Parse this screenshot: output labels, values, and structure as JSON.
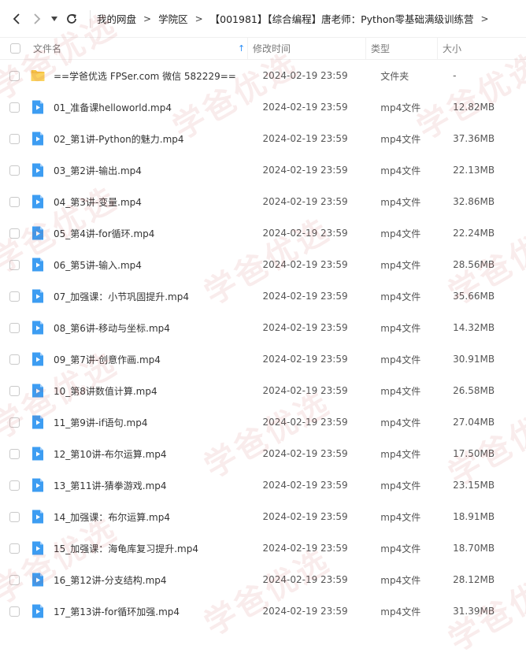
{
  "toolbar": {
    "back_icon": "chevron-left-icon",
    "forward_icon": "chevron-right-icon",
    "dropdown_icon": "caret-down-icon",
    "refresh_icon": "refresh-icon"
  },
  "breadcrumb": [
    {
      "label": "我的网盘"
    },
    {
      "label": "学院区"
    },
    {
      "label": "【001981】【综合编程】唐老师：Python零基础满级训练营"
    }
  ],
  "columns": {
    "name": "文件名",
    "modified": "修改时间",
    "type": "类型",
    "size": "大小",
    "sort_indicator": "↑"
  },
  "files": [
    {
      "icon": "folder-icon",
      "name": "==学爸优选 FPSer.com 微信 582229==",
      "modified": "2024-02-19 23:59",
      "type": "文件夹",
      "size": "-"
    },
    {
      "icon": "video-file-icon",
      "name": "01_准备课helloworld.mp4",
      "modified": "2024-02-19 23:59",
      "type": "mp4文件",
      "size": "12.82MB"
    },
    {
      "icon": "video-file-icon",
      "name": "02_第1讲-Python的魅力.mp4",
      "modified": "2024-02-19 23:59",
      "type": "mp4文件",
      "size": "37.36MB"
    },
    {
      "icon": "video-file-icon",
      "name": "03_第2讲-输出.mp4",
      "modified": "2024-02-19 23:59",
      "type": "mp4文件",
      "size": "22.13MB"
    },
    {
      "icon": "video-file-icon",
      "name": "04_第3讲-变量.mp4",
      "modified": "2024-02-19 23:59",
      "type": "mp4文件",
      "size": "32.86MB"
    },
    {
      "icon": "video-file-icon",
      "name": "05_第4讲-for循环.mp4",
      "modified": "2024-02-19 23:59",
      "type": "mp4文件",
      "size": "22.24MB"
    },
    {
      "icon": "video-file-icon",
      "name": "06_第5讲-输入.mp4",
      "modified": "2024-02-19 23:59",
      "type": "mp4文件",
      "size": "28.56MB"
    },
    {
      "icon": "video-file-icon",
      "name": "07_加强课：小节巩固提升.mp4",
      "modified": "2024-02-19 23:59",
      "type": "mp4文件",
      "size": "35.66MB"
    },
    {
      "icon": "video-file-icon",
      "name": "08_第6讲-移动与坐标.mp4",
      "modified": "2024-02-19 23:59",
      "type": "mp4文件",
      "size": "14.32MB"
    },
    {
      "icon": "video-file-icon",
      "name": "09_第7讲-创意作画.mp4",
      "modified": "2024-02-19 23:59",
      "type": "mp4文件",
      "size": "30.91MB"
    },
    {
      "icon": "video-file-icon",
      "name": "10_第8讲数值计算.mp4",
      "modified": "2024-02-19 23:59",
      "type": "mp4文件",
      "size": "26.58MB"
    },
    {
      "icon": "video-file-icon",
      "name": "11_第9讲-if语句.mp4",
      "modified": "2024-02-19 23:59",
      "type": "mp4文件",
      "size": "27.04MB"
    },
    {
      "icon": "video-file-icon",
      "name": "12_第10讲-布尔运算.mp4",
      "modified": "2024-02-19 23:59",
      "type": "mp4文件",
      "size": "17.50MB"
    },
    {
      "icon": "video-file-icon",
      "name": "13_第11讲-猜拳游戏.mp4",
      "modified": "2024-02-19 23:59",
      "type": "mp4文件",
      "size": "23.15MB"
    },
    {
      "icon": "video-file-icon",
      "name": "14_加强课：布尔运算.mp4",
      "modified": "2024-02-19 23:59",
      "type": "mp4文件",
      "size": "18.91MB"
    },
    {
      "icon": "video-file-icon",
      "name": "15_加强课：海龟库复习提升.mp4",
      "modified": "2024-02-19 23:59",
      "type": "mp4文件",
      "size": "18.70MB"
    },
    {
      "icon": "video-file-icon",
      "name": "16_第12讲-分支结构.mp4",
      "modified": "2024-02-19 23:59",
      "type": "mp4文件",
      "size": "28.12MB"
    },
    {
      "icon": "video-file-icon",
      "name": "17_第13讲-for循环加强.mp4",
      "modified": "2024-02-19 23:59",
      "type": "mp4文件",
      "size": "31.39MB"
    }
  ],
  "watermark": {
    "text": "学爸优选",
    "color": "#c84646"
  },
  "colors": {
    "accent": "#2b8ef7",
    "folder": "#f7c542",
    "video": "#3d9df2"
  }
}
